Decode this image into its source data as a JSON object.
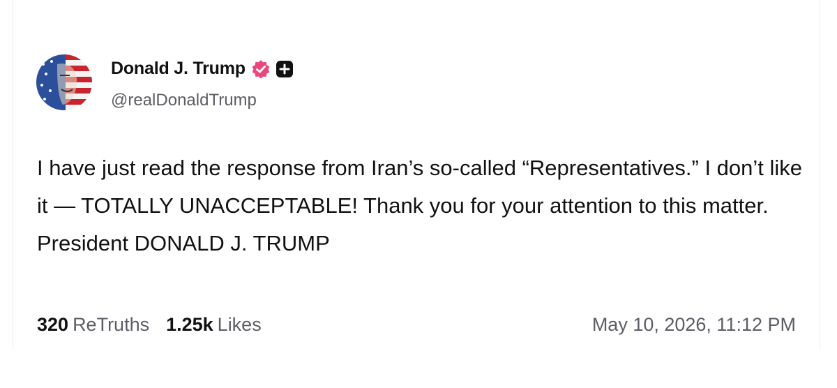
{
  "post": {
    "author": {
      "display_name": "Donald J. Trump",
      "handle": "@realDonaldTrump",
      "avatar_icon": "flag-portrait-avatar",
      "verified_icon": "verified-badge-icon",
      "verified_color": "#e8497a",
      "extra_badge_icon": "plus-badge-icon"
    },
    "text": "I have just read the response from Iran’s so-called “Representatives.” I don’t like it — TOTALLY UNACCEPTABLE! Thank you for your attention to this matter. President DONALD J. TRUMP",
    "retruths": {
      "count": "320",
      "label": "ReTruths"
    },
    "likes": {
      "count": "1.25k",
      "label": "Likes"
    },
    "timestamp": "May 10, 2026, 11:12 PM"
  }
}
